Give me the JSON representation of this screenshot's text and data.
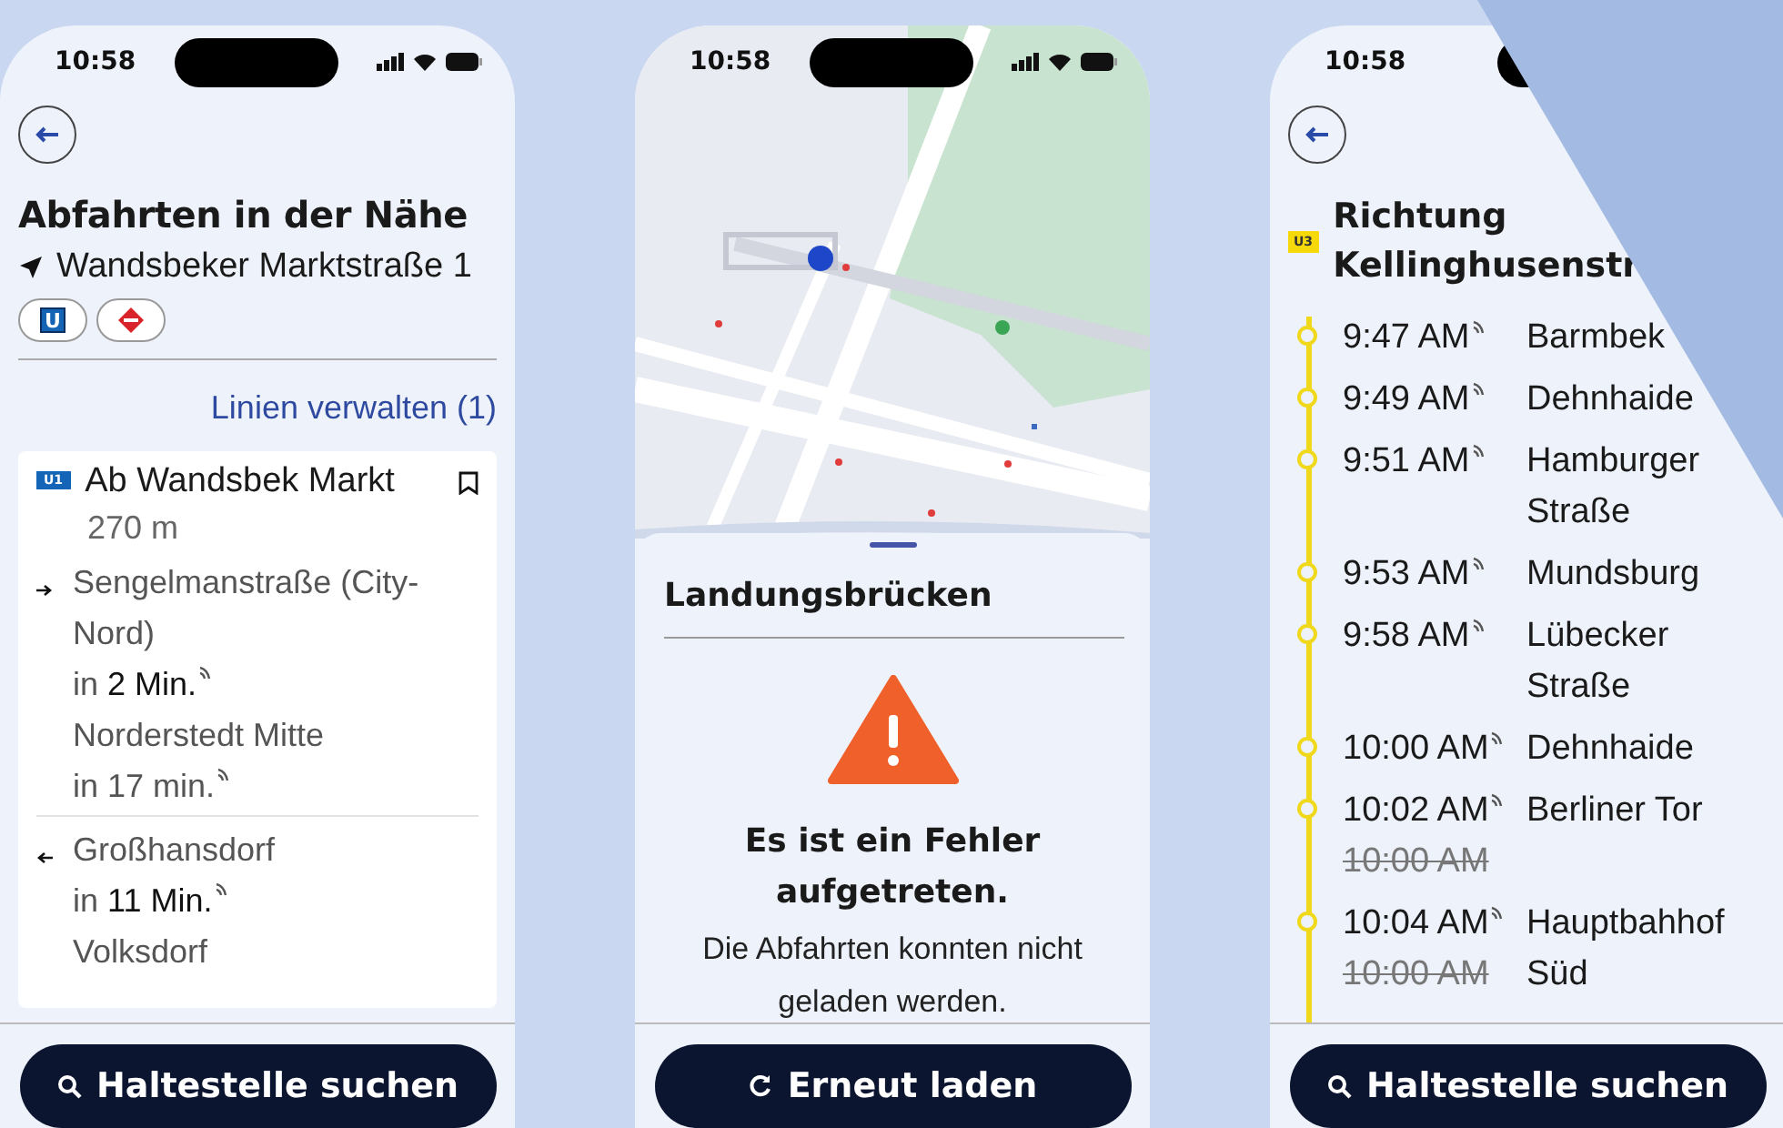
{
  "phones": [
    {
      "kind": "nearby",
      "time": "10:58",
      "status_icons": true,
      "title": "Abfahrten in der Nähe",
      "location": "Wandsbeker Marktstraße 1",
      "filters": [
        {
          "kind": "ubahn",
          "label": "U"
        },
        {
          "kind": "bus"
        }
      ],
      "manage_link": "Linien verwalten (1)",
      "stop": {
        "line": "U1",
        "name": "Ab Wandsbek Markt",
        "distance": "270 m",
        "groups": [
          {
            "kind": "outbound",
            "departures": [
              {
                "destination": "Sengelmanstraße (City-Nord)",
                "time": "in **2 Min.**",
                "realtime": true
              },
              {
                "destination": "Norderstedt Mitte",
                "time": "in 17 min.",
                "realtime": true
              }
            ]
          },
          {
            "kind": "inbound",
            "departures": [
              {
                "destination": "Großhansdorf",
                "time": "in **11 Min.**",
                "realtime": true
              },
              {
                "destination": "Volksdorf"
              }
            ]
          }
        ]
      },
      "button": {
        "kind": "search",
        "label": "Haltestelle suchen"
      }
    },
    {
      "kind": "error",
      "time": "10:58",
      "status_icons": true,
      "sheet_title": "Landungsbrücken",
      "error_title": "Es ist ein Fehler aufgetreten.",
      "error_message": "Die Abfahrten konnten nicht geladen werden.",
      "button": {
        "kind": "reload",
        "label": "Erneut laden"
      }
    },
    {
      "kind": "route",
      "time": "10:58",
      "status_icons": false,
      "line": "U3",
      "title": "Richtung Kellinghusenstr",
      "stops": [
        {
          "time": "9:47 AM",
          "realtime": true,
          "name": "Barmbek"
        },
        {
          "time": "9:49 AM",
          "realtime": true,
          "name": "Dehnhaide"
        },
        {
          "time": "9:51 AM",
          "realtime": true,
          "name": "Hamburger Straße"
        },
        {
          "time": "9:53 AM",
          "realtime": true,
          "name": "Mundsburg"
        },
        {
          "time": "9:58 AM",
          "realtime": true,
          "name": "Lübecker Straße"
        },
        {
          "time": "10:00 AM",
          "realtime": true,
          "name": "Dehnhaide"
        },
        {
          "time": "10:02 AM",
          "realtime": true,
          "scheduled": "10:00 AM",
          "name": "Berliner Tor"
        },
        {
          "time": "10:04 AM",
          "realtime": true,
          "scheduled": "10:00 AM",
          "name": "Hauptbahhof Süd"
        }
      ],
      "button": {
        "kind": "search",
        "label": "Haltestelle suchen"
      }
    }
  ]
}
